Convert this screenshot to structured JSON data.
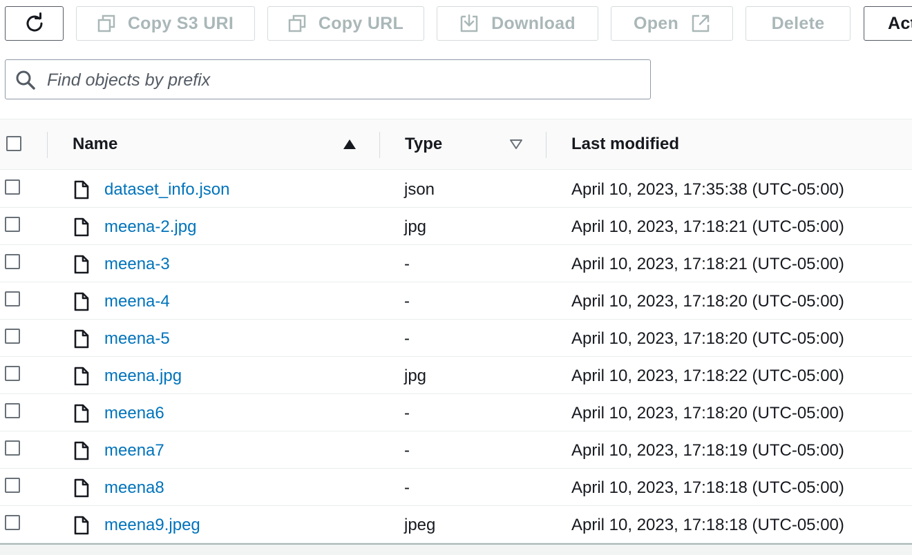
{
  "toolbar": {
    "refresh": {
      "icon": "refresh-icon"
    },
    "copy_s3_uri": {
      "label": "Copy S3 URI",
      "icon": "copy-icon"
    },
    "copy_url": {
      "label": "Copy URL",
      "icon": "copy-icon"
    },
    "download": {
      "label": "Download",
      "icon": "download-icon"
    },
    "open": {
      "label": "Open",
      "icon": "external-link-icon"
    },
    "delete": {
      "label": "Delete"
    },
    "actions": {
      "label": "Act"
    }
  },
  "search": {
    "placeholder": "Find objects by prefix",
    "value": "",
    "icon": "search-icon"
  },
  "table": {
    "columns": [
      {
        "label": "Name",
        "sort": "ascending"
      },
      {
        "label": "Type",
        "sort": "none"
      },
      {
        "label": "Last modified"
      }
    ],
    "rows": [
      {
        "name": "dataset_info.json",
        "type": "json",
        "modified": "April 10, 2023, 17:35:38 (UTC-05:00)"
      },
      {
        "name": "meena-2.jpg",
        "type": "jpg",
        "modified": "April 10, 2023, 17:18:21 (UTC-05:00)"
      },
      {
        "name": "meena-3",
        "type": "-",
        "modified": "April 10, 2023, 17:18:21 (UTC-05:00)"
      },
      {
        "name": "meena-4",
        "type": "-",
        "modified": "April 10, 2023, 17:18:20 (UTC-05:00)"
      },
      {
        "name": "meena-5",
        "type": "-",
        "modified": "April 10, 2023, 17:18:20 (UTC-05:00)"
      },
      {
        "name": "meena.jpg",
        "type": "jpg",
        "modified": "April 10, 2023, 17:18:22 (UTC-05:00)"
      },
      {
        "name": "meena6",
        "type": "-",
        "modified": "April 10, 2023, 17:18:20 (UTC-05:00)"
      },
      {
        "name": "meena7",
        "type": "-",
        "modified": "April 10, 2023, 17:18:19 (UTC-05:00)"
      },
      {
        "name": "meena8",
        "type": "-",
        "modified": "April 10, 2023, 17:18:18 (UTC-05:00)"
      },
      {
        "name": "meena9.jpeg",
        "type": "jpeg",
        "modified": "April 10, 2023, 17:18:18 (UTC-05:00)"
      }
    ]
  },
  "colors": {
    "link": "#0073bb",
    "text": "#16191f",
    "disabled": "#aab7b8",
    "border": "#d5dbdb"
  }
}
